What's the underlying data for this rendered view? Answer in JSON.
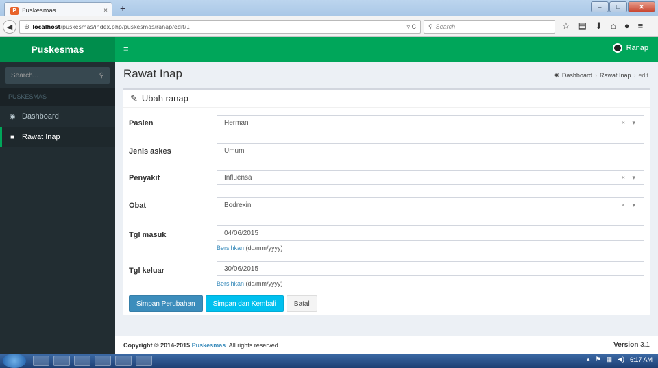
{
  "browser": {
    "tab_title": "Puskesmas",
    "tab_close": "×",
    "new_tab": "+",
    "url_host": "localhost",
    "url_path": "/puskesmas/index.php/puskesmas/ranap/edit/1",
    "search_placeholder": "Search"
  },
  "app": {
    "brand": "Puskesmas",
    "user_name": "Ranap"
  },
  "sidebar": {
    "search_placeholder": "Search...",
    "section_header": "PUSKESMAS",
    "items": [
      {
        "label": "Dashboard",
        "icon": "dashboard-icon"
      },
      {
        "label": "Rawat Inap",
        "icon": "briefcase-icon"
      }
    ]
  },
  "page": {
    "title": "Rawat Inap",
    "breadcrumb": [
      "Dashboard",
      "Rawat Inap",
      "edit"
    ]
  },
  "form": {
    "header": "Ubah ranap",
    "fields": [
      {
        "label": "Pasien",
        "value": "Herman"
      },
      {
        "label": "Jenis askes",
        "value": "Umum"
      },
      {
        "label": "Penyakit",
        "value": "Influensa"
      },
      {
        "label": "Obat",
        "value": "Bodrexin"
      },
      {
        "label": "Tgl masuk",
        "value": "04/06/2015",
        "help_link": "Bersihkan",
        "help_text": " (dd/mm/yyyy)"
      },
      {
        "label": "Tgl keluar",
        "value": "30/06/2015",
        "help_link": "Bersihkan",
        "help_text": " (dd/mm/yyyy)"
      }
    ],
    "buttons": {
      "save": "Simpan Perubahan",
      "save_back": "Simpan dan Kembali",
      "cancel": "Batal"
    }
  },
  "footer": {
    "copyright_prefix": "Copyright © 2014-2015 ",
    "brand_link": "Puskesmas",
    "copyright_suffix": ". All rights reserved.",
    "version_label": "Version",
    "version_number": "3.1"
  },
  "taskbar": {
    "clock": "6:17 AM"
  },
  "colors": {
    "brand_dark": "#008d4c",
    "header_green": "#00a65a",
    "sidebar_bg": "#222d32",
    "primary": "#3c8dbc",
    "info": "#00c0ef"
  }
}
